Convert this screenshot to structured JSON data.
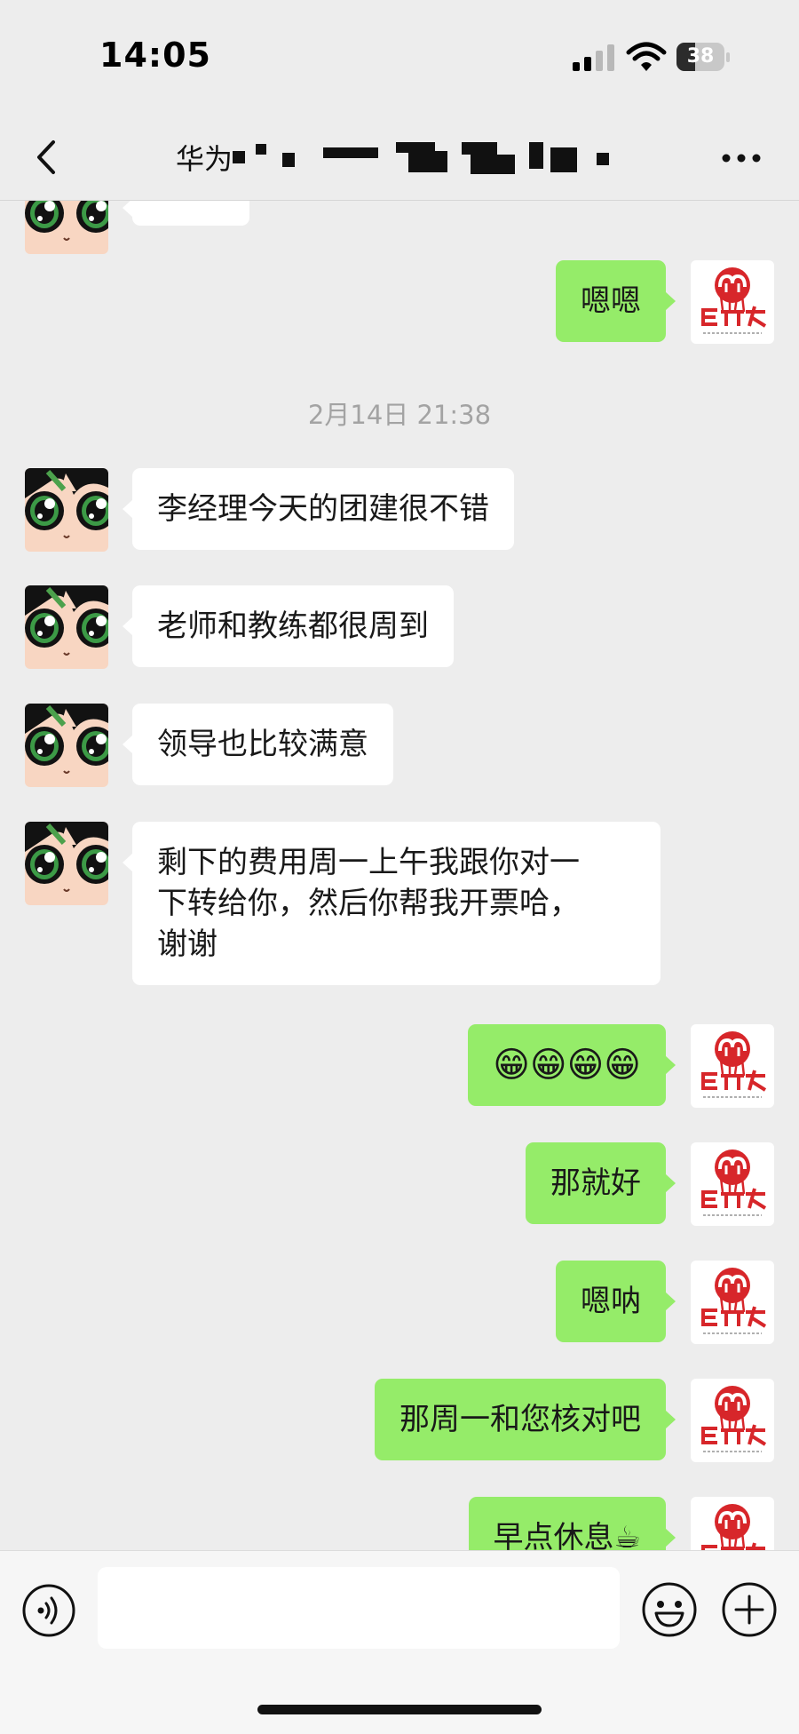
{
  "status_bar": {
    "time": "14:05",
    "battery_level": "38",
    "battery_percent": 38
  },
  "nav": {
    "title_visible": "华为",
    "title_redacted": true,
    "back_icon": "chevron-left-icon",
    "more_icon": "more-dots-icon"
  },
  "chat": {
    "timestamp": "2月14日 21:38",
    "messages": [
      {
        "side": "in",
        "text": ""
      },
      {
        "side": "out",
        "text": "嗯嗯"
      },
      {
        "side": "in",
        "text": "李经理今天的团建很不错"
      },
      {
        "side": "in",
        "text": "老师和教练都很周到"
      },
      {
        "side": "in",
        "text": "领导也比较满意"
      },
      {
        "side": "in",
        "text": "剩下的费用周一上午我跟你对一\n下转给你，然后你帮我开票哈，\n谢谢"
      },
      {
        "side": "out",
        "text": "😁😁😁😁"
      },
      {
        "side": "out",
        "text": "那就好"
      },
      {
        "side": "out",
        "text": "嗯呐"
      },
      {
        "side": "out",
        "text": "那周一和您核对吧"
      },
      {
        "side": "out",
        "text": "早点休息☕"
      }
    ]
  },
  "avatars": {
    "self_logo_text": "达尔文",
    "self_logo_url_text": "Erdarwin.com",
    "other_icon": "cartoon-face-icon"
  },
  "input_bar": {
    "placeholder": "",
    "voice_icon": "voice-icon",
    "emoji_icon": "emoji-icon",
    "plus_icon": "plus-icon"
  },
  "colors": {
    "background": "#ededed",
    "outgoing_bubble": "#95ec69",
    "incoming_bubble": "#ffffff",
    "logo_red": "#d7262a"
  }
}
